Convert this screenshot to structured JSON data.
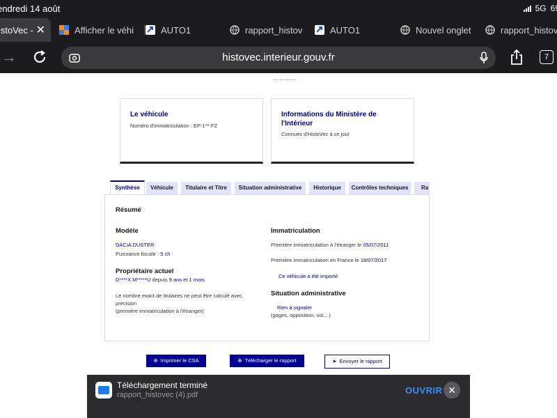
{
  "status_bar": {
    "time": "endredi 14 août",
    "network": "5G",
    "battery": "69"
  },
  "browser": {
    "tabs": [
      {
        "label": "istoVec -",
        "favicon": "page-icon",
        "active": true
      },
      {
        "label": "Afficher le véhi",
        "favicon": "colored-squares-icon"
      },
      {
        "label": "AUTO1",
        "favicon": "blue-arrow-icon"
      },
      {
        "label": "rapport_histov",
        "favicon": "globe-icon"
      },
      {
        "label": "AUTO1",
        "favicon": "blue-arrow-icon"
      },
      {
        "label": "Nouvel onglet",
        "favicon": "globe-icon"
      },
      {
        "label": "rapport_histov",
        "favicon": "globe-icon"
      }
    ],
    "url": "histovec.interieur.gouv.fr",
    "tab_count": "7"
  },
  "cards": [
    {
      "title": "Le véhicule",
      "text": "Numéro d'immatriculation : EP-1**-FZ"
    },
    {
      "title_line1": "Informations du Ministère de",
      "title_line2": "l'Intérieur",
      "text": "Connues d'HistoVec à ce jour"
    }
  ],
  "report_tabs": [
    "Synthèse",
    "Véhicule",
    "Titulaire et Titre",
    "Situation administrative",
    "Historique",
    "Contrôles techniques",
    "Ra"
  ],
  "summary": {
    "title": "Résumé",
    "modele": {
      "heading": "Modèle",
      "name": "DACIA DUSTER",
      "power_label": "Puissance fiscale : ",
      "power_value": "5 ch"
    },
    "proprietaire": {
      "heading": "Propriétaire actuel",
      "name": "D****X M*****U",
      "since_label": "depuis",
      "since_value": "9 ans et 1 mois",
      "note_line1": "Le nombre exact de titulaires ne peut être calculé avec",
      "note_line2": "précision",
      "note_line3": "(première immatriculation à l'étranger)"
    },
    "immatriculation": {
      "heading": "Immatriculation",
      "first_abroad_label": "Première immatriculation à l'étranger le",
      "first_abroad_date": "05/07/2011",
      "first_france_label": "Première immatriculation en France le",
      "first_france_date": "18/07/2017",
      "imported": "Ce véhicule a été importé"
    },
    "situation": {
      "heading": "Situation administrative",
      "status": "Rien à signaler",
      "detail": "(gages, opposition, vol,...)"
    }
  },
  "actions": {
    "print": "Imprimer le CSA",
    "download": "Télécharger le rapport",
    "send": "Envoyer le rapport"
  },
  "download_banner": {
    "title": "Téléchargement terminé",
    "filename": "rapport_histovec (4).pdf",
    "open_label": "OUVRIR"
  }
}
